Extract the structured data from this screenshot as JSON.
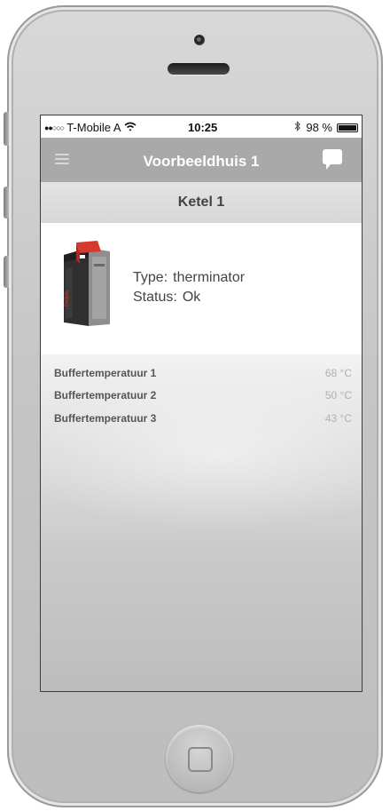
{
  "status_bar": {
    "signal_dots": "●●○○○",
    "carrier": "T-Mobile A",
    "wifi_icon": "wifi-icon",
    "time": "10:25",
    "bluetooth_icon": "bluetooth-icon",
    "battery_text": "98 %",
    "battery_level": 0.98
  },
  "nav_bar": {
    "menu_icon": "hamburger-menu-icon",
    "title": "Voorbeeldhuis 1",
    "chat_icon": "chat-bubble-icon"
  },
  "section": {
    "title": "Ketel 1"
  },
  "device": {
    "image": "pellet-boiler-image",
    "brand_text": "Pellets",
    "type_label": "Type:",
    "type_value": "therminator",
    "status_label": "Status:",
    "status_value": "Ok"
  },
  "sensors": [
    {
      "name": "Buffertemperatuur 1",
      "value": "68 °C"
    },
    {
      "name": "Buffertemperatuur 2",
      "value": "50 °C"
    },
    {
      "name": "Buffertemperatuur 3",
      "value": "43 °C"
    }
  ],
  "colors": {
    "nav_bar": "#a9a9a9",
    "header": "#d9d9d9",
    "boiler_red": "#d63a2f",
    "value_gray": "#b0b0b0"
  }
}
